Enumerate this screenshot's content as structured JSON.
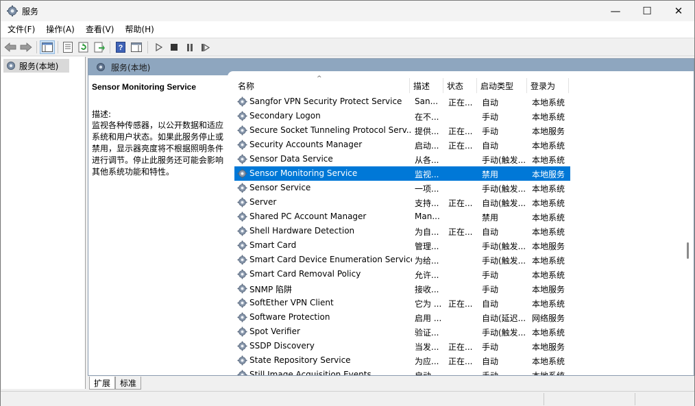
{
  "window": {
    "title": "服务",
    "controls": {
      "minimize": "—",
      "maximize": "☐",
      "close": "✕"
    }
  },
  "menu": [
    "文件(F)",
    "操作(A)",
    "查看(V)",
    "帮助(H)"
  ],
  "tree": {
    "root_label": "服务(本地)"
  },
  "main": {
    "header_title": "服务(本地)",
    "description": {
      "service_name": "Sensor Monitoring Service",
      "label": "描述:",
      "text": "监视各种传感器，以公开数据和适应系统和用户状态。如果此服务停止或禁用，显示器亮度将不根据照明条件进行调节。停止此服务还可能会影响其他系统功能和特性。"
    },
    "columns": [
      "名称",
      "描述",
      "状态",
      "启动类型",
      "登录为"
    ],
    "sort_arrow": "^",
    "services": [
      {
        "name": "Sangfor VPN Security Protect Service",
        "desc": "San...",
        "state": "正在...",
        "start": "自动",
        "logon": "本地系统"
      },
      {
        "name": "Secondary Logon",
        "desc": "在不...",
        "state": "",
        "start": "手动",
        "logon": "本地系统"
      },
      {
        "name": "Secure Socket Tunneling Protocol Serv...",
        "desc": "提供...",
        "state": "正在...",
        "start": "手动",
        "logon": "本地服务"
      },
      {
        "name": "Security Accounts Manager",
        "desc": "启动...",
        "state": "正在...",
        "start": "自动",
        "logon": "本地系统"
      },
      {
        "name": "Sensor Data Service",
        "desc": "从各...",
        "state": "",
        "start": "手动(触发...",
        "logon": "本地系统"
      },
      {
        "name": "Sensor Monitoring Service",
        "desc": "监视...",
        "state": "",
        "start": "禁用",
        "logon": "本地服务",
        "selected": true
      },
      {
        "name": "Sensor Service",
        "desc": "一项...",
        "state": "",
        "start": "手动(触发...",
        "logon": "本地系统"
      },
      {
        "name": "Server",
        "desc": "支持...",
        "state": "正在...",
        "start": "自动(触发...",
        "logon": "本地系统"
      },
      {
        "name": "Shared PC Account Manager",
        "desc": "Man...",
        "state": "",
        "start": "禁用",
        "logon": "本地系统"
      },
      {
        "name": "Shell Hardware Detection",
        "desc": "为自...",
        "state": "正在...",
        "start": "自动",
        "logon": "本地系统"
      },
      {
        "name": "Smart Card",
        "desc": "管理...",
        "state": "",
        "start": "手动(触发...",
        "logon": "本地服务"
      },
      {
        "name": "Smart Card Device Enumeration Service",
        "desc": "为给...",
        "state": "",
        "start": "手动(触发...",
        "logon": "本地系统"
      },
      {
        "name": "Smart Card Removal Policy",
        "desc": "允许...",
        "state": "",
        "start": "手动",
        "logon": "本地系统"
      },
      {
        "name": "SNMP 陷阱",
        "desc": "接收...",
        "state": "",
        "start": "手动",
        "logon": "本地服务"
      },
      {
        "name": "SoftEther VPN Client",
        "desc": "它为 ...",
        "state": "正在...",
        "start": "自动",
        "logon": "本地系统"
      },
      {
        "name": "Software Protection",
        "desc": "启用 ...",
        "state": "",
        "start": "自动(延迟...",
        "logon": "网络服务"
      },
      {
        "name": "Spot Verifier",
        "desc": "验证...",
        "state": "",
        "start": "手动(触发...",
        "logon": "本地系统"
      },
      {
        "name": "SSDP Discovery",
        "desc": "当发...",
        "state": "正在...",
        "start": "手动",
        "logon": "本地服务"
      },
      {
        "name": "State Repository Service",
        "desc": "为应...",
        "state": "正在...",
        "start": "自动",
        "logon": "本地系统"
      },
      {
        "name": "Still Image Acquisition Events",
        "desc": "启动...",
        "state": "",
        "start": "手动",
        "logon": "本地系统"
      }
    ]
  },
  "tabs": [
    "扩展",
    "标准"
  ],
  "colors": {
    "selection": "#0078d7",
    "header_band": "#8ea6bf"
  }
}
